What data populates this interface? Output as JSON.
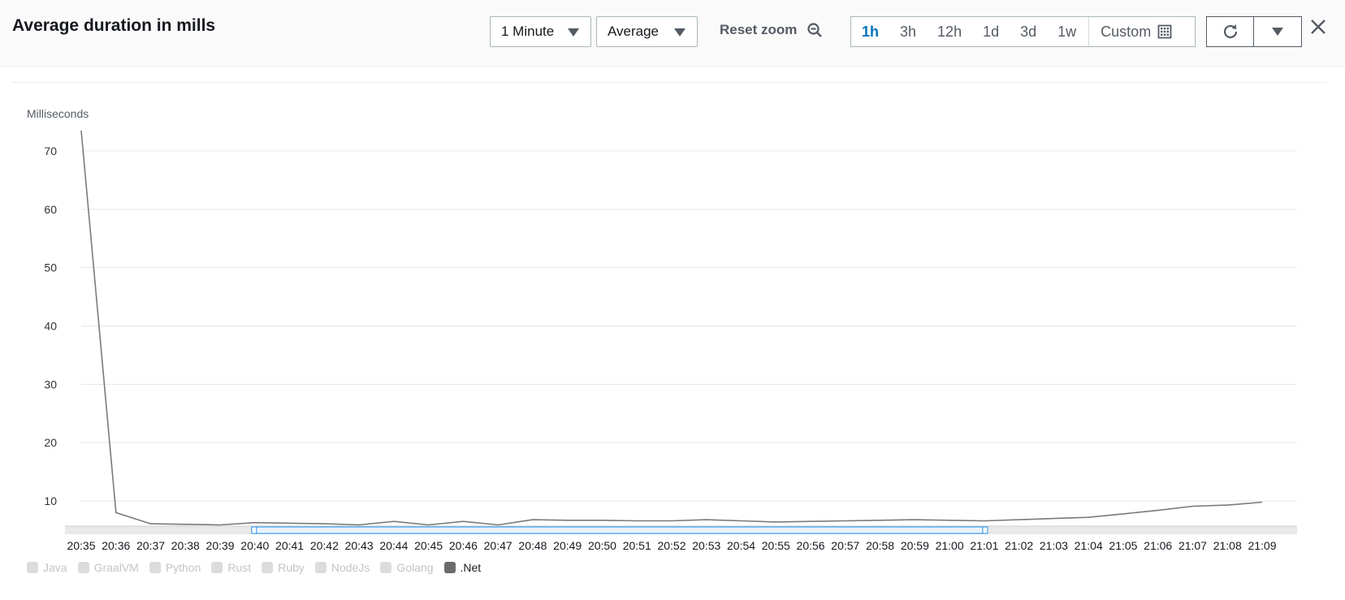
{
  "header": {
    "title": "Average duration in mills",
    "period_select": "1 Minute",
    "stat_select": "Average",
    "reset_zoom": "Reset zoom",
    "ranges": [
      "1h",
      "3h",
      "12h",
      "1d",
      "3d",
      "1w"
    ],
    "active_range": "1h",
    "custom": "Custom"
  },
  "colors": {
    "line": "#7a7a7a",
    "accent": "#0073bb",
    "brush": "#1f8ff5"
  },
  "chart_data": {
    "type": "line",
    "ylabel": "Milliseconds",
    "ylim": [
      5,
      75
    ],
    "yticks": [
      10,
      20,
      30,
      40,
      50,
      60,
      70
    ],
    "grid": true,
    "x": [
      "20:35",
      "20:36",
      "20:37",
      "20:38",
      "20:39",
      "20:40",
      "20:41",
      "20:42",
      "20:43",
      "20:44",
      "20:45",
      "20:46",
      "20:47",
      "20:48",
      "20:49",
      "20:50",
      "20:51",
      "20:52",
      "20:53",
      "20:54",
      "20:55",
      "20:56",
      "20:57",
      "20:58",
      "20:59",
      "21:00",
      "21:01",
      "21:02",
      "21:03",
      "21:04",
      "21:05",
      "21:06",
      "21:07",
      "21:08",
      "21:09"
    ],
    "series": [
      {
        "name": ".Net",
        "values": [
          73.5,
          8.0,
          6.1,
          6.0,
          5.9,
          6.3,
          6.2,
          6.1,
          5.9,
          6.5,
          5.9,
          6.5,
          5.9,
          6.8,
          6.7,
          6.7,
          6.6,
          6.6,
          6.8,
          6.6,
          6.4,
          6.5,
          6.6,
          6.7,
          6.8,
          6.7,
          6.6,
          6.8,
          7.0,
          7.2,
          7.8,
          8.4,
          9.1,
          9.3,
          9.8
        ]
      }
    ],
    "brush_range": [
      "20:40",
      "21:01"
    ],
    "legend": [
      {
        "label": "Java",
        "on": false
      },
      {
        "label": "GraalVM",
        "on": false
      },
      {
        "label": "Python",
        "on": false
      },
      {
        "label": "Rust",
        "on": false
      },
      {
        "label": "Ruby",
        "on": false
      },
      {
        "label": "NodeJs",
        "on": false
      },
      {
        "label": "Golang",
        "on": false
      },
      {
        "label": ".Net",
        "on": true
      }
    ]
  }
}
